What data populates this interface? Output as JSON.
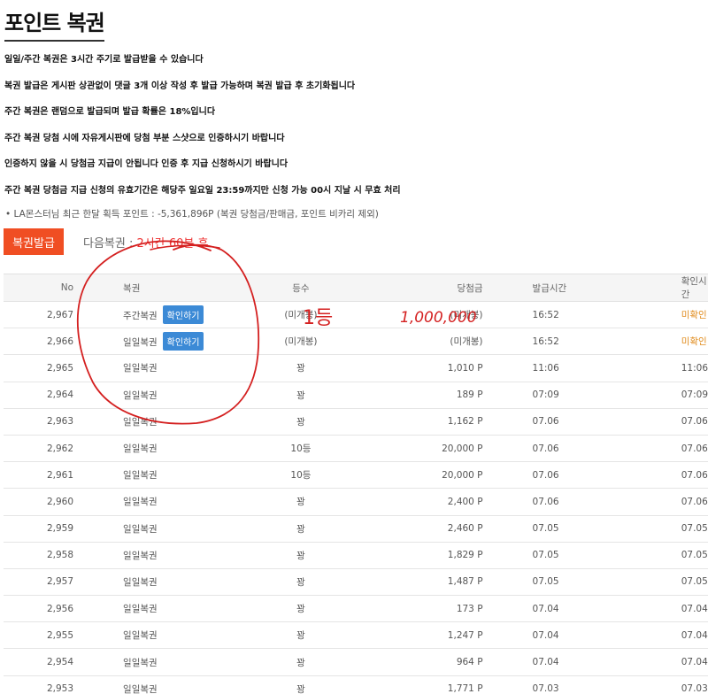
{
  "page_title": "포인트 복권",
  "notices": [
    "일일/주간 복권은 3시간 주기로 발급받을 수 있습니다",
    "복권 발급은 게시판 상관없이 댓글 3개 이상 작성 후 발급 가능하며 복권 발급 후 초기화됩니다",
    "주간 복권은 랜덤으로 발급되며 발급 확률은 18%입니다",
    "주간 복권 당첨 시에 자유게시판에 당첨 부분 스샷으로 인증하시기 바랍니다",
    "인증하지 않을 시 당첨금 지급이 안됩니다 인증 후 지급 신청하시기 바랍니다",
    "주간 복권 당첨금 지급 신청의 유효기간은 해당주 일요일 23:59까지만 신청 가능 00시 지날 시 무효 처리"
  ],
  "sub_info": "• LA몬스터님 최근 한달 획득 포인트 : -5,361,896P (복권 당첨금/판매금, 포인트 비카리 제외)",
  "issue_button": "복권발급",
  "next_label": "다음복권 : ",
  "next_value": "2시간 60분 후",
  "columns": {
    "no": "No",
    "ticket": "복권",
    "grade": "등수",
    "prize": "당첨금",
    "issued": "발급시간",
    "confirmed": "확인시간"
  },
  "check_button": "확인하기",
  "rows": [
    {
      "no": "2,967",
      "ticket": "주간복권",
      "check": true,
      "grade": "(미개봉)",
      "prize": "(미개봉)",
      "issued": "16:52",
      "confirmed": "미확인"
    },
    {
      "no": "2,966",
      "ticket": "일일복권",
      "check": true,
      "grade": "(미개봉)",
      "prize": "(미개봉)",
      "issued": "16:52",
      "confirmed": "미확인"
    },
    {
      "no": "2,965",
      "ticket": "일일복권",
      "check": false,
      "grade": "꽝",
      "prize": "1,010 P",
      "issued": "11:06",
      "confirmed": "11:06"
    },
    {
      "no": "2,964",
      "ticket": "일일복권",
      "check": false,
      "grade": "꽝",
      "prize": "189 P",
      "issued": "07:09",
      "confirmed": "07:09"
    },
    {
      "no": "2,963",
      "ticket": "일일복권",
      "check": false,
      "grade": "꽝",
      "prize": "1,162 P",
      "issued": "07.06",
      "confirmed": "07.06"
    },
    {
      "no": "2,962",
      "ticket": "일일복권",
      "check": false,
      "grade": "10등",
      "prize": "20,000 P",
      "issued": "07.06",
      "confirmed": "07.06"
    },
    {
      "no": "2,961",
      "ticket": "일일복권",
      "check": false,
      "grade": "10등",
      "prize": "20,000 P",
      "issued": "07.06",
      "confirmed": "07.06"
    },
    {
      "no": "2,960",
      "ticket": "일일복권",
      "check": false,
      "grade": "꽝",
      "prize": "2,400 P",
      "issued": "07.06",
      "confirmed": "07.06"
    },
    {
      "no": "2,959",
      "ticket": "일일복권",
      "check": false,
      "grade": "꽝",
      "prize": "2,460 P",
      "issued": "07.05",
      "confirmed": "07.05"
    },
    {
      "no": "2,958",
      "ticket": "일일복권",
      "check": false,
      "grade": "꽝",
      "prize": "1,829 P",
      "issued": "07.05",
      "confirmed": "07.05"
    },
    {
      "no": "2,957",
      "ticket": "일일복권",
      "check": false,
      "grade": "꽝",
      "prize": "1,487 P",
      "issued": "07.05",
      "confirmed": "07.05"
    },
    {
      "no": "2,956",
      "ticket": "일일복권",
      "check": false,
      "grade": "꽝",
      "prize": "173 P",
      "issued": "07.04",
      "confirmed": "07.04"
    },
    {
      "no": "2,955",
      "ticket": "일일복권",
      "check": false,
      "grade": "꽝",
      "prize": "1,247 P",
      "issued": "07.04",
      "confirmed": "07.04"
    },
    {
      "no": "2,954",
      "ticket": "일일복권",
      "check": false,
      "grade": "꽝",
      "prize": "964 P",
      "issued": "07.04",
      "confirmed": "07.04"
    },
    {
      "no": "2,953",
      "ticket": "일일복권",
      "check": false,
      "grade": "꽝",
      "prize": "1,771 P",
      "issued": "07.03",
      "confirmed": "07.03"
    }
  ],
  "annotation": {
    "grade_note": "1등",
    "prize_note": "1,000,000",
    "color": "#d42020"
  },
  "colors": {
    "accent": "#f04e23",
    "check_button": "#3c8ad6",
    "unconfirmed": "#e08b1c"
  }
}
